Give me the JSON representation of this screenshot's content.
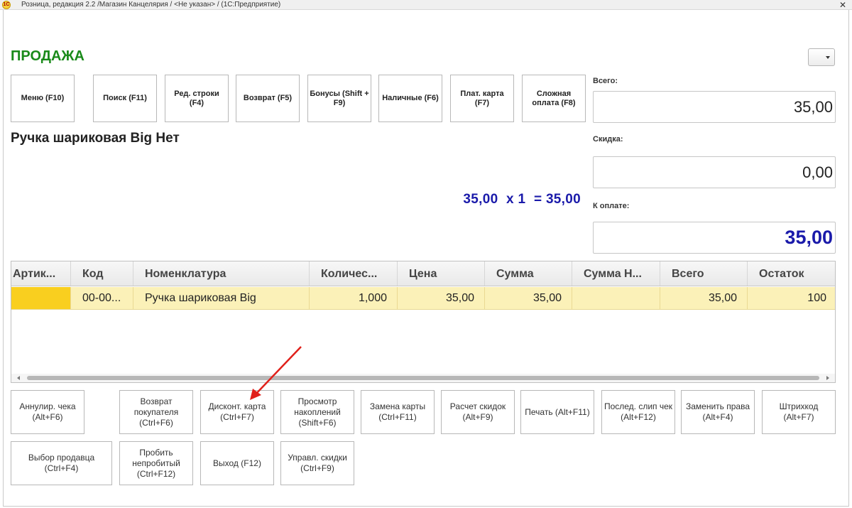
{
  "window": {
    "title": "Розница, редакция 2.2 /Магазин Канцелярия / <Не указан> /  (1С:Предприятие)",
    "logo_text": "1С",
    "close_glyph": "✕"
  },
  "header": {
    "title": "ПРОДАЖА"
  },
  "function_buttons": [
    {
      "label": "Меню (F10)"
    },
    {
      "label": "Поиск (F11)"
    },
    {
      "label": "Ред. строки (F4)"
    },
    {
      "label": "Возврат (F5)"
    },
    {
      "label": "Бонусы (Shift + F9)"
    },
    {
      "label": "Наличные (F6)"
    },
    {
      "label": "Плат. карта (F7)"
    },
    {
      "label": "Сложная оплата (F8)"
    }
  ],
  "current_item": {
    "name": "Ручка шариковая Big Нет",
    "price": "35,00",
    "times": "x 1",
    "equals": "= 35,00"
  },
  "totals": {
    "total_label": "Всего:",
    "total_value": "35,00",
    "discount_label": "Скидка:",
    "discount_value": "0,00",
    "pay_label": "К оплате:",
    "pay_value": "35,00"
  },
  "table": {
    "columns": [
      "Артик...",
      "Код",
      "Номенклатура",
      "Количес...",
      "Цена",
      "Сумма",
      "Сумма Н...",
      "Всего",
      "Остаток"
    ],
    "rows": [
      [
        "",
        "00-00...",
        "Ручка шариковая Big",
        "1,000",
        "35,00",
        "35,00",
        "",
        "35,00",
        "100"
      ]
    ]
  },
  "bottom_buttons_row1": [
    {
      "label": "Аннулир. чека (Alt+F6)"
    },
    {
      "label": "Возврат покупателя (Ctrl+F6)"
    },
    {
      "label": "Дисконт. карта (Ctrl+F7)"
    },
    {
      "label": "Просмотр накоплений (Shift+F6)"
    },
    {
      "label": "Замена карты (Ctrl+F11)"
    },
    {
      "label": "Расчет скидок (Alt+F9)"
    },
    {
      "label": "Печать (Alt+F11)"
    },
    {
      "label": "Послед. слип чек (Alt+F12)"
    },
    {
      "label": "Заменить права (Alt+F4)"
    },
    {
      "label": "Штрихкод (Alt+F7)"
    }
  ],
  "bottom_buttons_row2": [
    {
      "label": "Выбор продавца (Ctrl+F4)"
    },
    {
      "label": "Пробить непробитый (Ctrl+F12)"
    },
    {
      "label": "Выход (F12)"
    },
    {
      "label": "Управл. скидки (Ctrl+F9)"
    }
  ],
  "colors": {
    "title_green": "#1a8a1a",
    "amount_blue": "#1a1aaa",
    "row_highlight": "#fbf1b8",
    "cell_selected": "#f9cf1f",
    "annotation_red": "#e0201a"
  }
}
